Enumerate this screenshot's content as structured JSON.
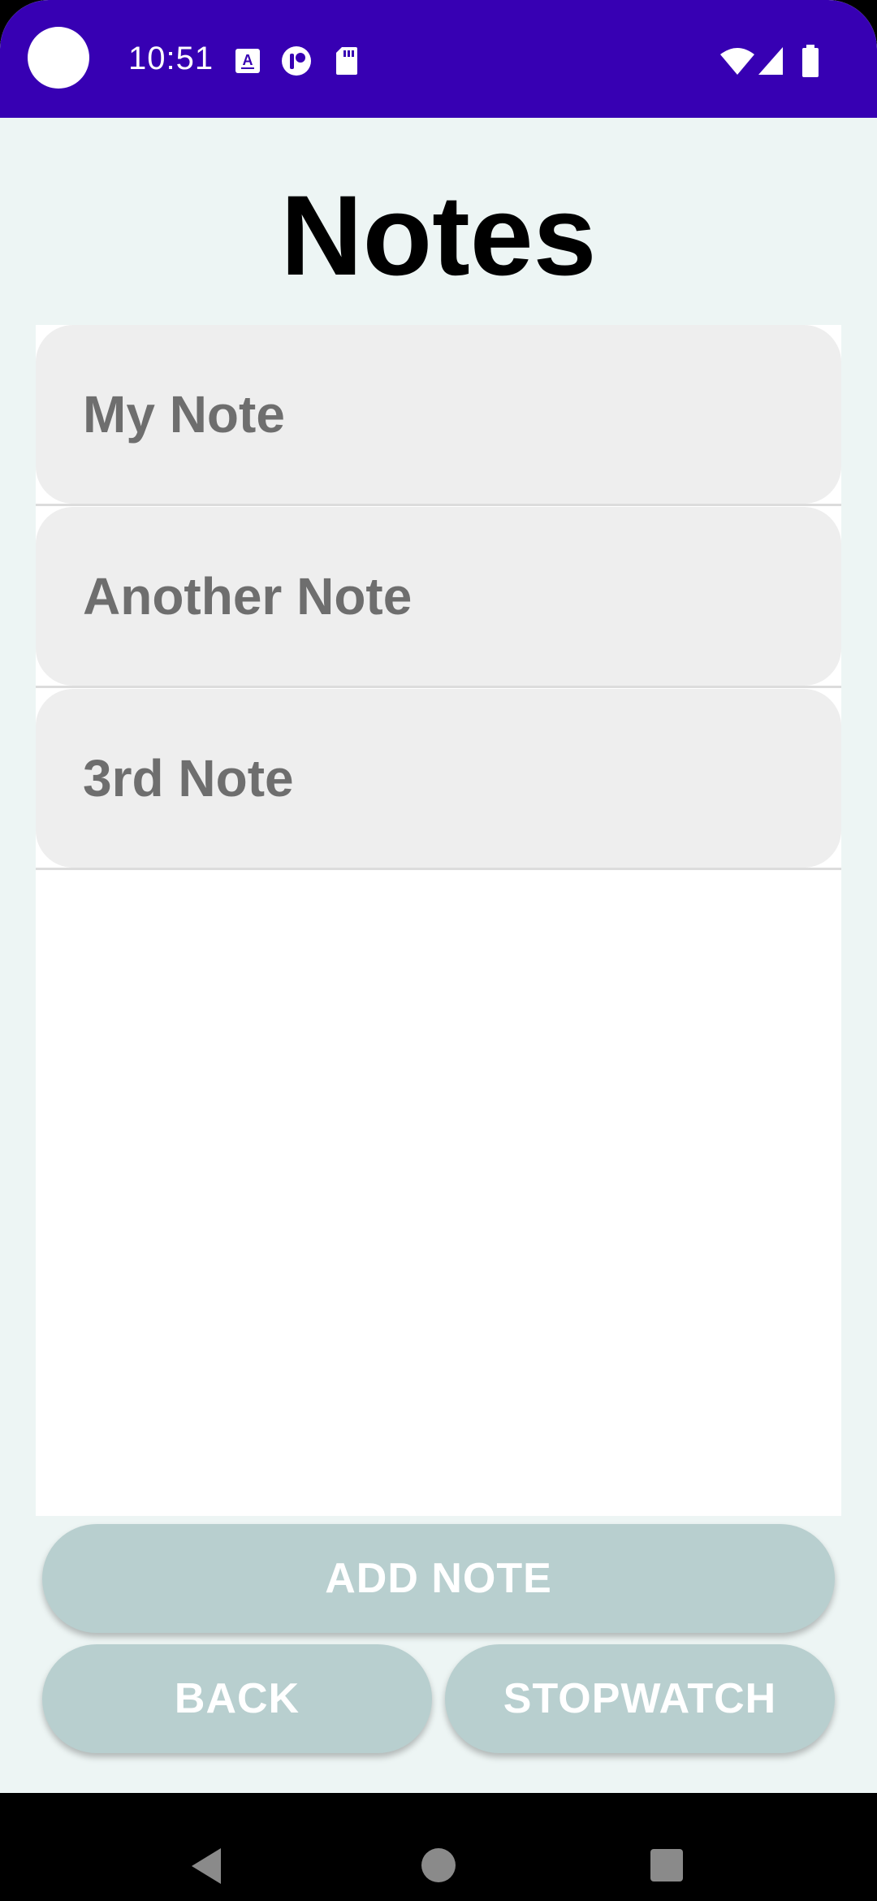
{
  "status_bar": {
    "time": "10:51",
    "icons": [
      "camera-cutout-icon",
      "accessibility-a-icon",
      "app-notification-icon",
      "sd-card-icon",
      "wifi-icon",
      "cell-signal-icon",
      "battery-icon"
    ]
  },
  "page": {
    "title": "Notes"
  },
  "notes": [
    {
      "label": "My Note"
    },
    {
      "label": "Another Note"
    },
    {
      "label": "3rd Note"
    }
  ],
  "buttons": {
    "add_note": "ADD NOTE",
    "back": "BACK",
    "stopwatch": "STOPWATCH"
  },
  "nav_bar": {
    "icons": [
      "back-triangle-icon",
      "home-circle-icon",
      "recents-square-icon"
    ]
  },
  "colors": {
    "status_bar": "#3700B3",
    "background": "#EDF5F4",
    "note_item": "#EEEEEE",
    "note_text": "#6E6E6E",
    "button": "#B8CFCF"
  }
}
